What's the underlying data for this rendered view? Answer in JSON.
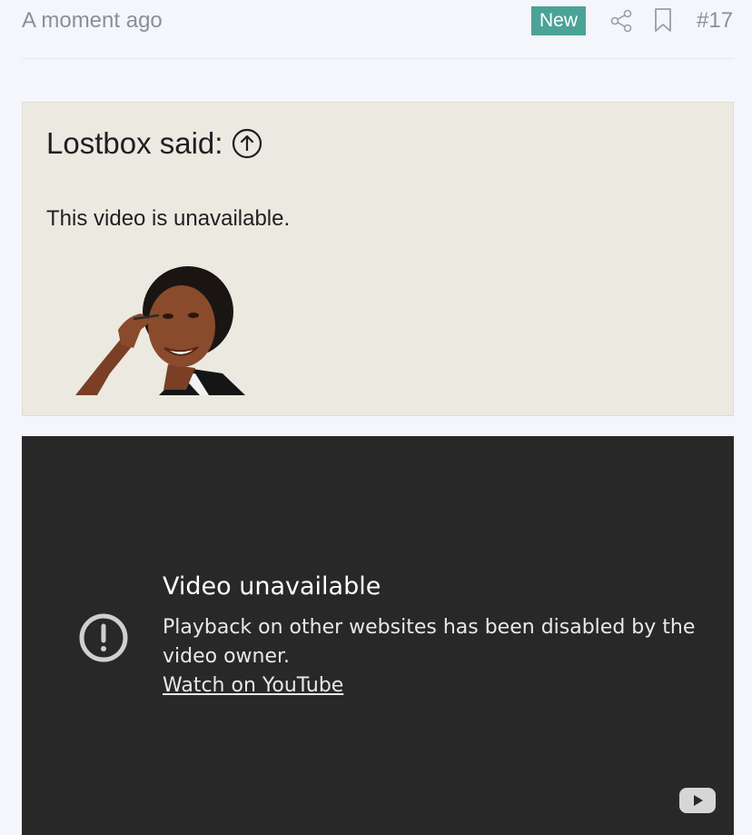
{
  "post": {
    "timestamp": "A moment ago",
    "badge": "New",
    "number": "#17",
    "share_icon": "share-icon",
    "bookmark_icon": "bookmark-icon",
    "colors": {
      "badge_bg": "#4aa396",
      "meta_text": "#8c8f96"
    }
  },
  "quote": {
    "author_label": "Lostbox said:",
    "jump_icon": "arrow-up-circle-icon",
    "text": "This video is unavailable.",
    "image": "photo of a smiling woman holding glasses",
    "background": "#ebe9e0"
  },
  "video": {
    "title": "Video unavailable",
    "message": "Playback on other websites has been disabled by the video owner.",
    "link_label": "Watch on YouTube",
    "alert_icon": "alert-circle-icon",
    "logo_icon": "youtube-logo-icon",
    "background": "#282828"
  }
}
